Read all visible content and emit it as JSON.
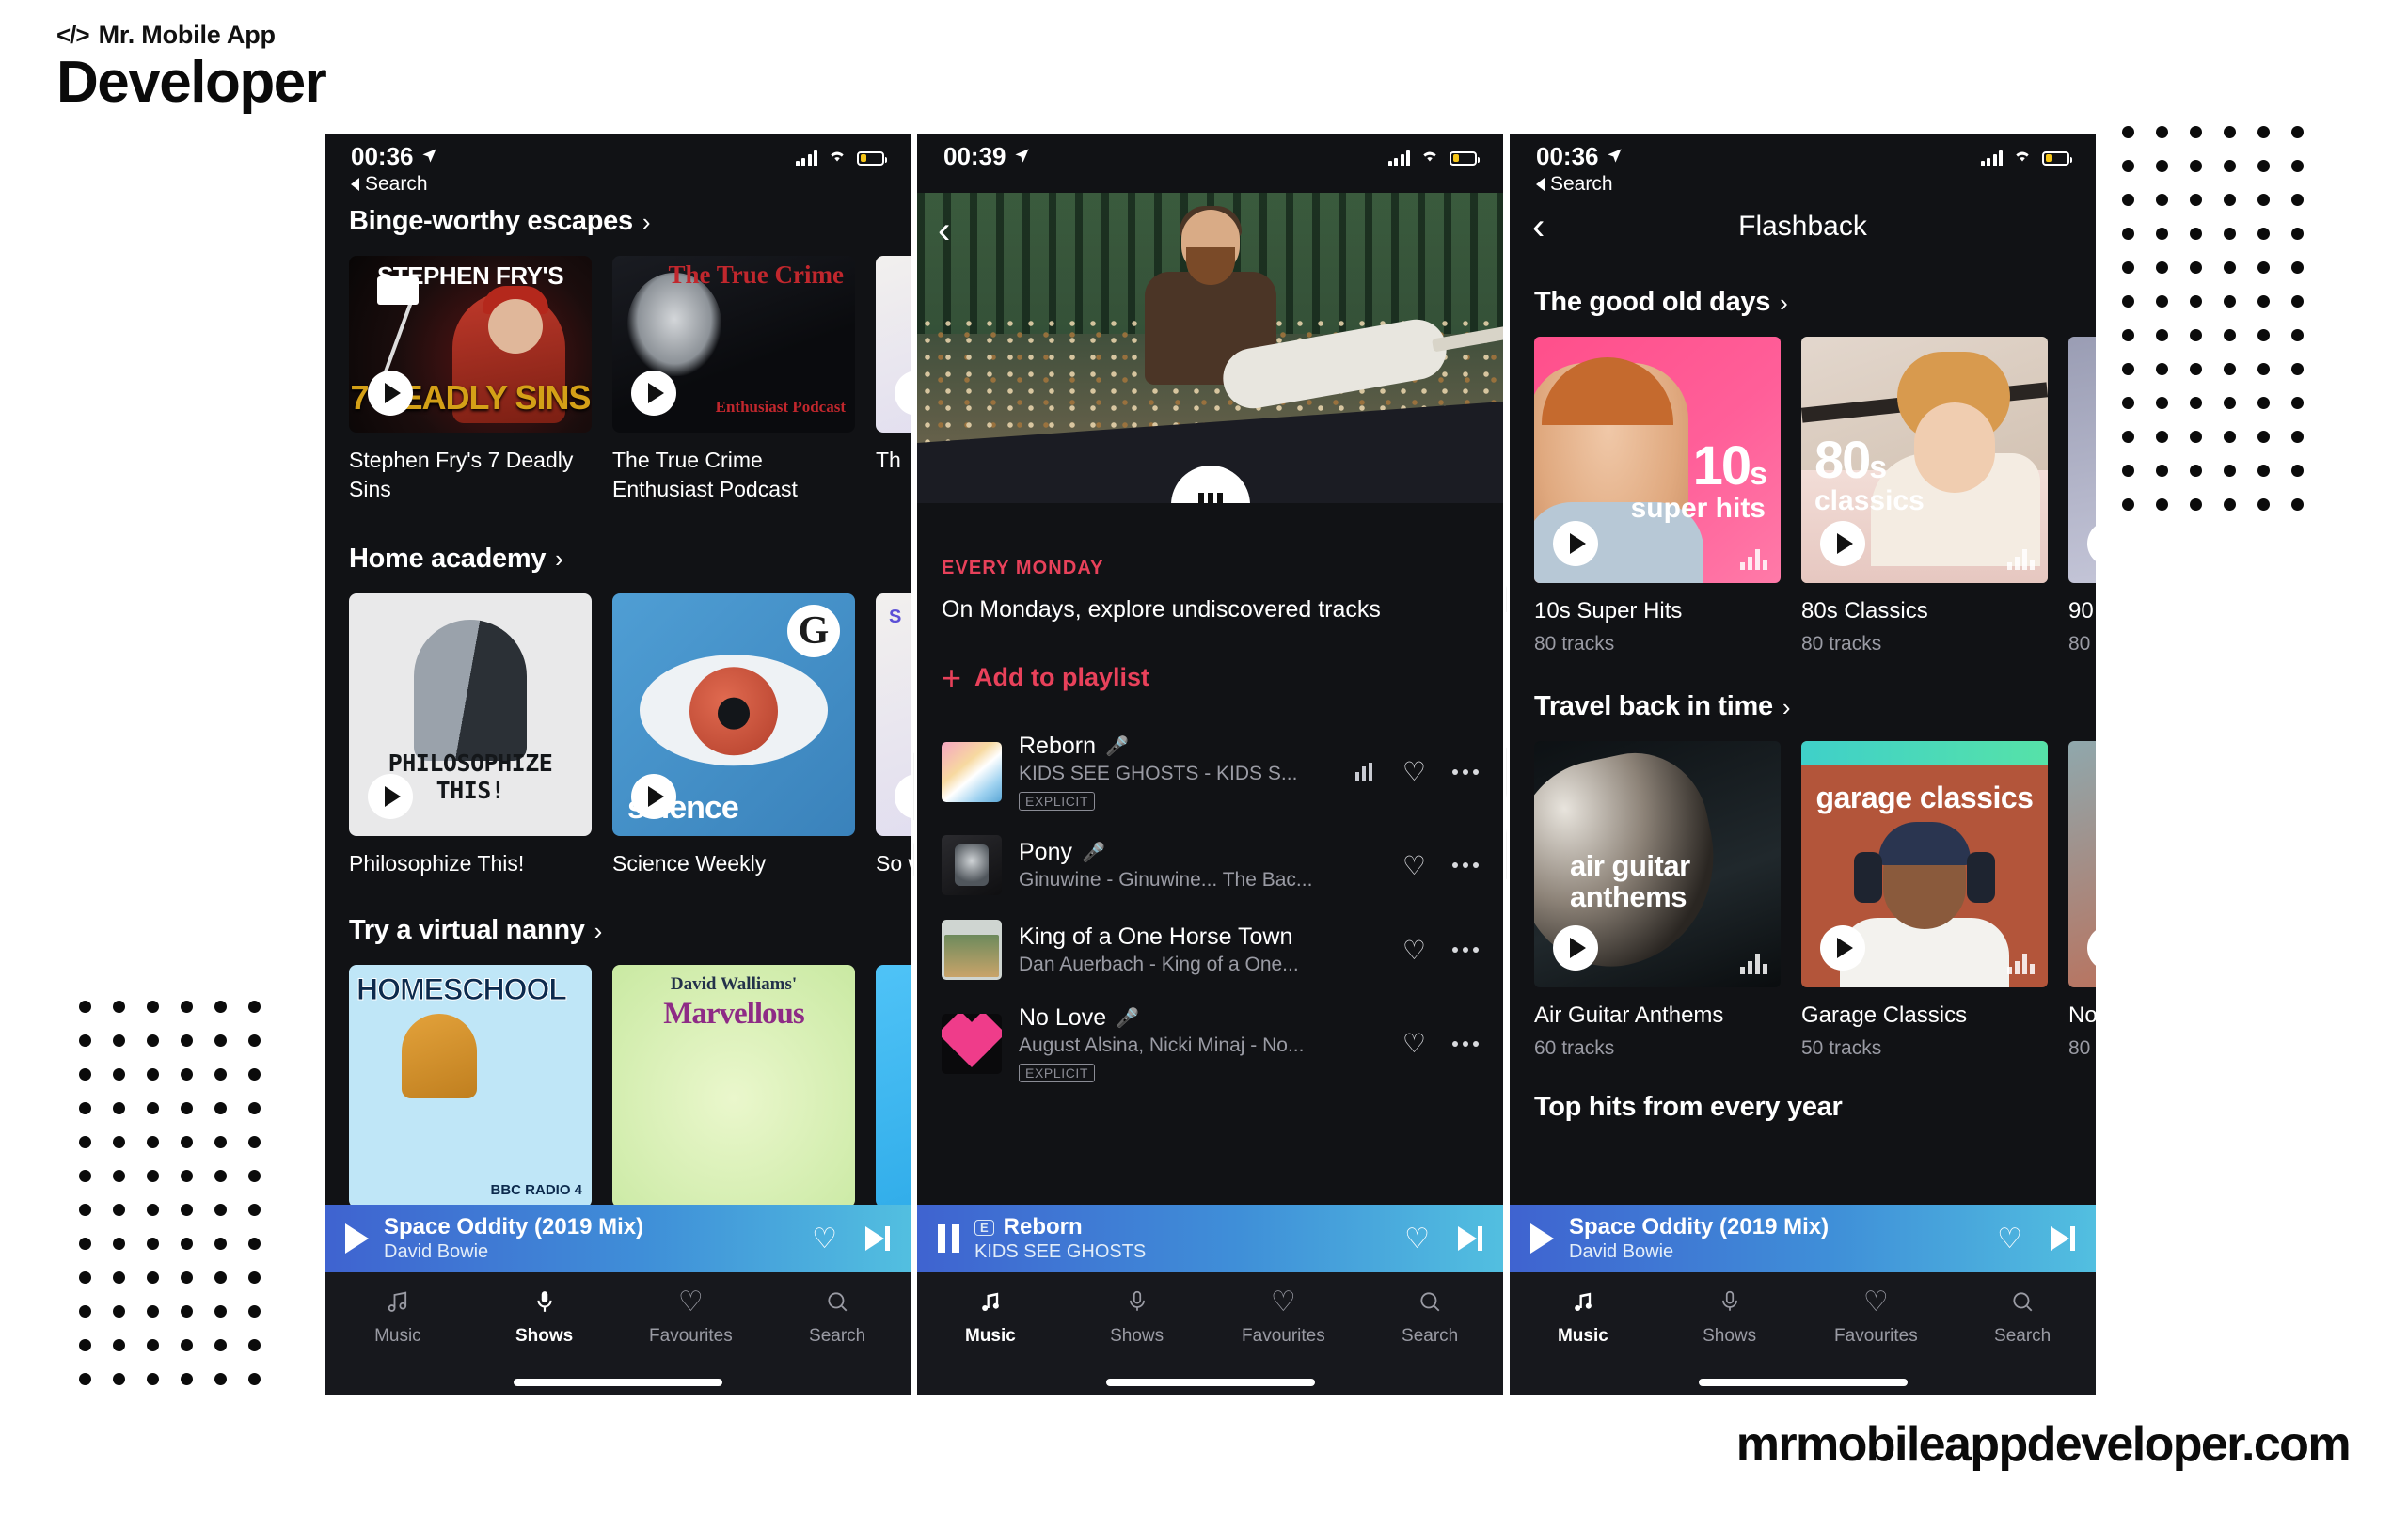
{
  "branding": {
    "code_glyph": "</>",
    "top_line": "Mr. Mobile App",
    "main_line": "Developer",
    "footer_url": "mrmobileappdeveloper.com",
    "watermark_line1": "Mr. Mobile App",
    "watermark_line2": "Developer"
  },
  "phones": [
    {
      "id": "shows-browse",
      "status": {
        "time": "00:36",
        "back_label": "Search",
        "location_icon": "location-arrow-icon",
        "signal_icon": "signal-bars-icon",
        "wifi_icon": "wifi-icon",
        "battery_icon": "battery-icon"
      },
      "sections": [
        {
          "title": "Binge-worthy escapes",
          "chevron": "›",
          "cards": [
            {
              "title": "Stephen Fry's 7 Deadly Sins",
              "art": "art-fry",
              "art_top_text": "STEPHEN FRY'S",
              "art_bottom_text": "7 DEADLY SINS"
            },
            {
              "title": "The True Crime Enthusiast Podcast",
              "art": "art-truecrime",
              "art_top_text": "The True Crime",
              "art_bottom_text": "Enthusiast Podcast"
            },
            {
              "title": "Th",
              "art": "art-third",
              "art_top_text": "",
              "art_bottom_text": ""
            }
          ]
        },
        {
          "title": "Home academy",
          "chevron": "›",
          "cards": [
            {
              "title": "Philosophize This!",
              "art": "art-philo",
              "art_top_text": "",
              "art_bottom_text": "PHILOSOPHIZE THIS!"
            },
            {
              "title": "Science Weekly",
              "art": "art-science",
              "art_top_text": "G",
              "art_bottom_text": "science"
            },
            {
              "title": "So wi",
              "art": "art-third",
              "art_top_text": "S",
              "art_bottom_text": ""
            }
          ]
        },
        {
          "title": "Try a virtual nanny",
          "chevron": "›",
          "cards": [
            {
              "title": "",
              "art": "art-homeschool",
              "art_top_text": "HOMESCHOOL",
              "art_bottom_text": "BBC RADIO 4"
            },
            {
              "title": "",
              "art": "art-walliams",
              "art_top_text": "David Walliams'",
              "art_bottom_text": "Marvellous"
            },
            {
              "title": "",
              "art": "art-blue",
              "art_top_text": "",
              "art_bottom_text": ""
            }
          ]
        }
      ],
      "nowplaying": {
        "state": "play",
        "play_icon": "play-icon",
        "title": "Space Oddity (2019 Mix)",
        "artist": "David Bowie",
        "explicit": "",
        "heart_icon": "heart-outline-icon",
        "next_icon": "skip-next-icon"
      },
      "tabs": [
        {
          "label": "Music",
          "icon": "music-note-icon",
          "active": false
        },
        {
          "label": "Shows",
          "icon": "microphone-icon",
          "active": true
        },
        {
          "label": "Favourites",
          "icon": "heart-outline-icon",
          "active": false
        },
        {
          "label": "Search",
          "icon": "search-icon",
          "active": false
        }
      ]
    },
    {
      "id": "playlist-detail",
      "status": {
        "time": "00:39",
        "back_label": "",
        "location_icon": "location-arrow-icon",
        "signal_icon": "signal-bars-icon",
        "wifi_icon": "wifi-icon",
        "battery_icon": "battery-icon"
      },
      "back_chevron": "‹",
      "hero": {
        "pause_icon": "pause-icon"
      },
      "kicker": "EVERY MONDAY",
      "description": "On Mondays, explore undiscovered tracks",
      "add_label": "Add to playlist",
      "add_icon": "plus-icon",
      "tracks": [
        {
          "title": "Reborn",
          "subtitle": "KIDS SEE GHOSTS - KIDS S...",
          "explicit": "EXPLICIT",
          "playing": true,
          "art": "ta-reborn",
          "mic_icon": "microphone-small-icon",
          "heart_icon": "heart-outline-icon",
          "more_icon": "more-dots-icon"
        },
        {
          "title": "Pony",
          "subtitle": "Ginuwine - Ginuwine... The Bac...",
          "explicit": "",
          "playing": false,
          "art": "ta-pony",
          "mic_icon": "microphone-small-icon",
          "heart_icon": "heart-outline-icon",
          "more_icon": "more-dots-icon"
        },
        {
          "title": "King of a One Horse Town",
          "subtitle": "Dan Auerbach - King of a One...",
          "explicit": "",
          "playing": false,
          "art": "ta-king",
          "mic_icon": "",
          "heart_icon": "heart-outline-icon",
          "more_icon": "more-dots-icon"
        },
        {
          "title": "No Love",
          "subtitle": "August Alsina, Nicki Minaj - No...",
          "explicit": "EXPLICIT",
          "playing": false,
          "art": "ta-nolove",
          "mic_icon": "microphone-small-icon",
          "heart_icon": "heart-outline-icon",
          "more_icon": "more-dots-icon"
        }
      ],
      "nowplaying": {
        "state": "pause",
        "play_icon": "pause-icon",
        "title": "Reborn",
        "artist": "KIDS SEE GHOSTS",
        "explicit": "E",
        "heart_icon": "heart-outline-icon",
        "next_icon": "skip-next-icon"
      },
      "tabs": [
        {
          "label": "Music",
          "icon": "music-note-icon",
          "active": true
        },
        {
          "label": "Shows",
          "icon": "microphone-icon",
          "active": false
        },
        {
          "label": "Favourites",
          "icon": "heart-outline-icon",
          "active": false
        },
        {
          "label": "Search",
          "icon": "search-icon",
          "active": false
        }
      ]
    },
    {
      "id": "flashback",
      "status": {
        "time": "00:36",
        "back_label": "Search",
        "location_icon": "location-arrow-icon",
        "signal_icon": "signal-bars-icon",
        "wifi_icon": "wifi-icon",
        "battery_icon": "battery-icon"
      },
      "nav": {
        "title": "Flashback",
        "back_chevron": "‹"
      },
      "sections": [
        {
          "title": "The good old days",
          "chevron": "›",
          "cards": [
            {
              "name": "10s Super Hits",
              "tracks": "80 tracks",
              "art": "art-10s",
              "art_big": "10",
              "art_small": "s",
              "art_sub": "super hits"
            },
            {
              "name": "80s Classics",
              "tracks": "80 tracks",
              "art": "art-80s",
              "art_big": "80",
              "art_small": "s",
              "art_sub": "classics"
            },
            {
              "name": "90",
              "tracks": "80",
              "art": "art-90s",
              "art_big": "",
              "art_small": "",
              "art_sub": ""
            }
          ]
        },
        {
          "title": "Travel back in time",
          "chevron": "›",
          "cards": [
            {
              "name": "Air Guitar Anthems",
              "tracks": "60 tracks",
              "art": "art-air",
              "art_big": "",
              "art_small": "",
              "art_sub": "air guitar anthems"
            },
            {
              "name": "Garage Classics",
              "tracks": "50 tracks",
              "art": "art-garage",
              "art_big": "",
              "art_small": "",
              "art_sub": "garage classics"
            },
            {
              "name": "No",
              "tracks": "80",
              "art": "art-nineties",
              "art_big": "",
              "art_small": "",
              "art_sub": ""
            }
          ]
        }
      ],
      "third_section_title": "Top hits from every year",
      "third_section_chevron": "",
      "nowplaying": {
        "state": "play",
        "play_icon": "play-icon",
        "title": "Space Oddity (2019 Mix)",
        "artist": "David Bowie",
        "explicit": "",
        "heart_icon": "heart-outline-icon",
        "next_icon": "skip-next-icon"
      },
      "tabs": [
        {
          "label": "Music",
          "icon": "music-note-icon",
          "active": true
        },
        {
          "label": "Shows",
          "icon": "microphone-icon",
          "active": false
        },
        {
          "label": "Favourites",
          "icon": "heart-outline-icon",
          "active": false
        },
        {
          "label": "Search",
          "icon": "search-icon",
          "active": false
        }
      ]
    }
  ],
  "decor": {
    "dotgrid_topright": {
      "cols": 6,
      "rows": 12
    },
    "dotgrid_bottomleft": {
      "cols": 6,
      "rows": 12
    }
  },
  "colors": {
    "accent_red": "#e8415a",
    "player_gradient_start": "#3f63d0",
    "player_gradient_end": "#52bfe0",
    "screen_bg": "#111215",
    "tabbar_bg": "#17181d"
  }
}
